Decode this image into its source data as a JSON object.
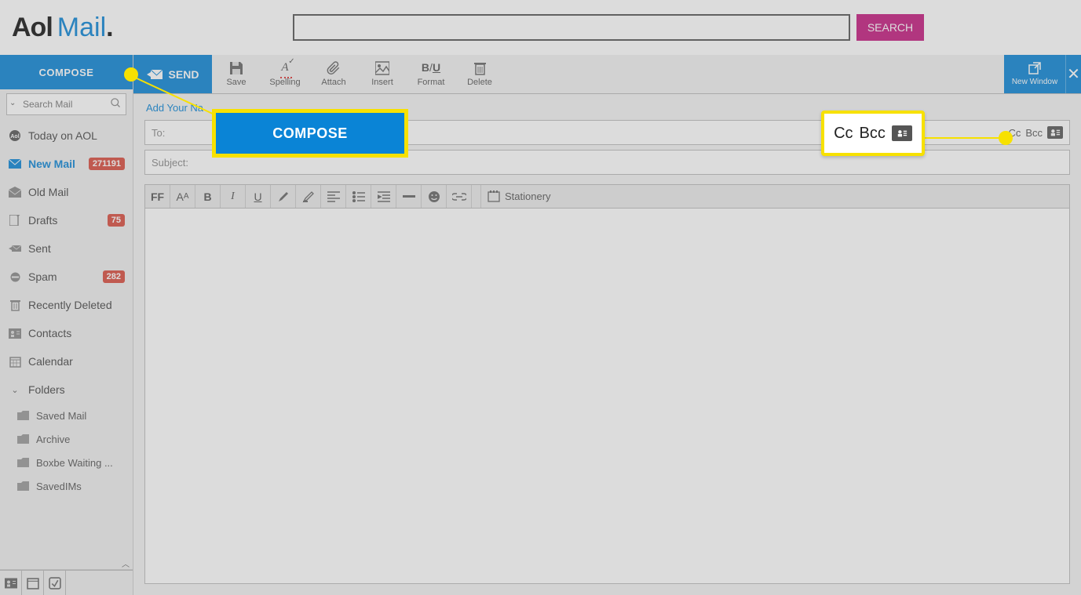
{
  "header": {
    "logo_aol": "Aol",
    "logo_mail": "Mail",
    "logo_dot": ".",
    "search_button": "SEARCH"
  },
  "sidebar": {
    "compose": "COMPOSE",
    "search_placeholder": "Search Mail",
    "items": [
      {
        "label": "Today on AOL"
      },
      {
        "label": "New Mail",
        "badge": "271191"
      },
      {
        "label": "Old Mail"
      },
      {
        "label": "Drafts",
        "badge": "75"
      },
      {
        "label": "Sent"
      },
      {
        "label": "Spam",
        "badge": "282"
      },
      {
        "label": "Recently Deleted"
      },
      {
        "label": "Contacts"
      },
      {
        "label": "Calendar"
      }
    ],
    "folders_label": "Folders",
    "folders": [
      {
        "label": "Saved Mail"
      },
      {
        "label": "Archive"
      },
      {
        "label": "Boxbe Waiting ..."
      },
      {
        "label": "SavedIMs"
      }
    ]
  },
  "toolbar": {
    "send": "SEND",
    "save": "Save",
    "spelling": "Spelling",
    "attach": "Attach",
    "insert": "Insert",
    "format": "Format",
    "delete": "Delete",
    "new_window": "New Window"
  },
  "compose": {
    "add_name": "Add Your Na",
    "to_label": "To:",
    "subject_label": "Subject:",
    "cc": "Cc",
    "bcc": "Bcc",
    "stationery": "Stationery",
    "ff": "FF",
    "aa": "A",
    "aa_small": "A"
  },
  "callouts": {
    "compose_label": "COMPOSE",
    "cc": "Cc",
    "bcc": "Bcc"
  }
}
